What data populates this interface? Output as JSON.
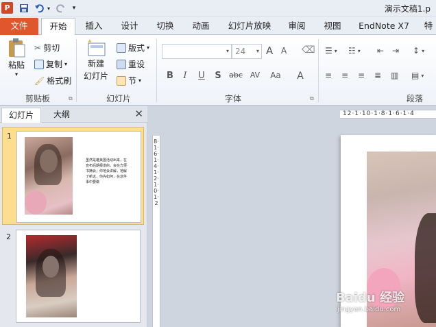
{
  "titlebar": {
    "app_icon": "P",
    "doc_title": "演示文稿1.p",
    "qat_icons": [
      "save-icon",
      "undo-icon",
      "redo-icon",
      "customize-icon"
    ]
  },
  "tabs": [
    "文件",
    "开始",
    "插入",
    "设计",
    "切换",
    "动画",
    "幻灯片放映",
    "审阅",
    "视图",
    "EndNote X7",
    "特"
  ],
  "ribbon": {
    "clipboard": {
      "paste": "粘贴",
      "cut": "剪切",
      "copy": "复制",
      "format_painter": "格式刷",
      "label": "剪贴板"
    },
    "slides": {
      "new_slide_line1": "新建",
      "new_slide_line2": "幻灯片",
      "layout": "版式",
      "reset": "重设",
      "section": "节",
      "label": "幻灯片"
    },
    "font": {
      "font_size": "24",
      "grow": "A",
      "shrink": "A",
      "bold": "B",
      "italic": "I",
      "underline": "U",
      "shadow": "S",
      "strike": "abc",
      "spacing": "AV",
      "case": "Aa",
      "color": "A",
      "label": "字体"
    },
    "paragraph": {
      "label": "段落"
    }
  },
  "panel": {
    "tab_slides": "幻灯片",
    "tab_outline": "大纲",
    "slide1_num": "1",
    "slide2_num": "2",
    "slide1_text": "虽然是雄美国活动出来，在宣布后期报道的，会在方便书摘会；你地会讲解，地解了新这，你先如何，在这件事中要做"
  },
  "rulers": {
    "horizontal": "12·1·10·1·8·1·6·1·4",
    "vertical": "8·1·6·1·4·1·2·1·0·1·2"
  },
  "watermark": {
    "brand": "Baidu 经验",
    "url": "jingyan.baidu.com"
  },
  "colors": {
    "file_tab": "#e2562d",
    "accent": "#fcdf8e",
    "ribbon_bg": "#ffffff"
  }
}
